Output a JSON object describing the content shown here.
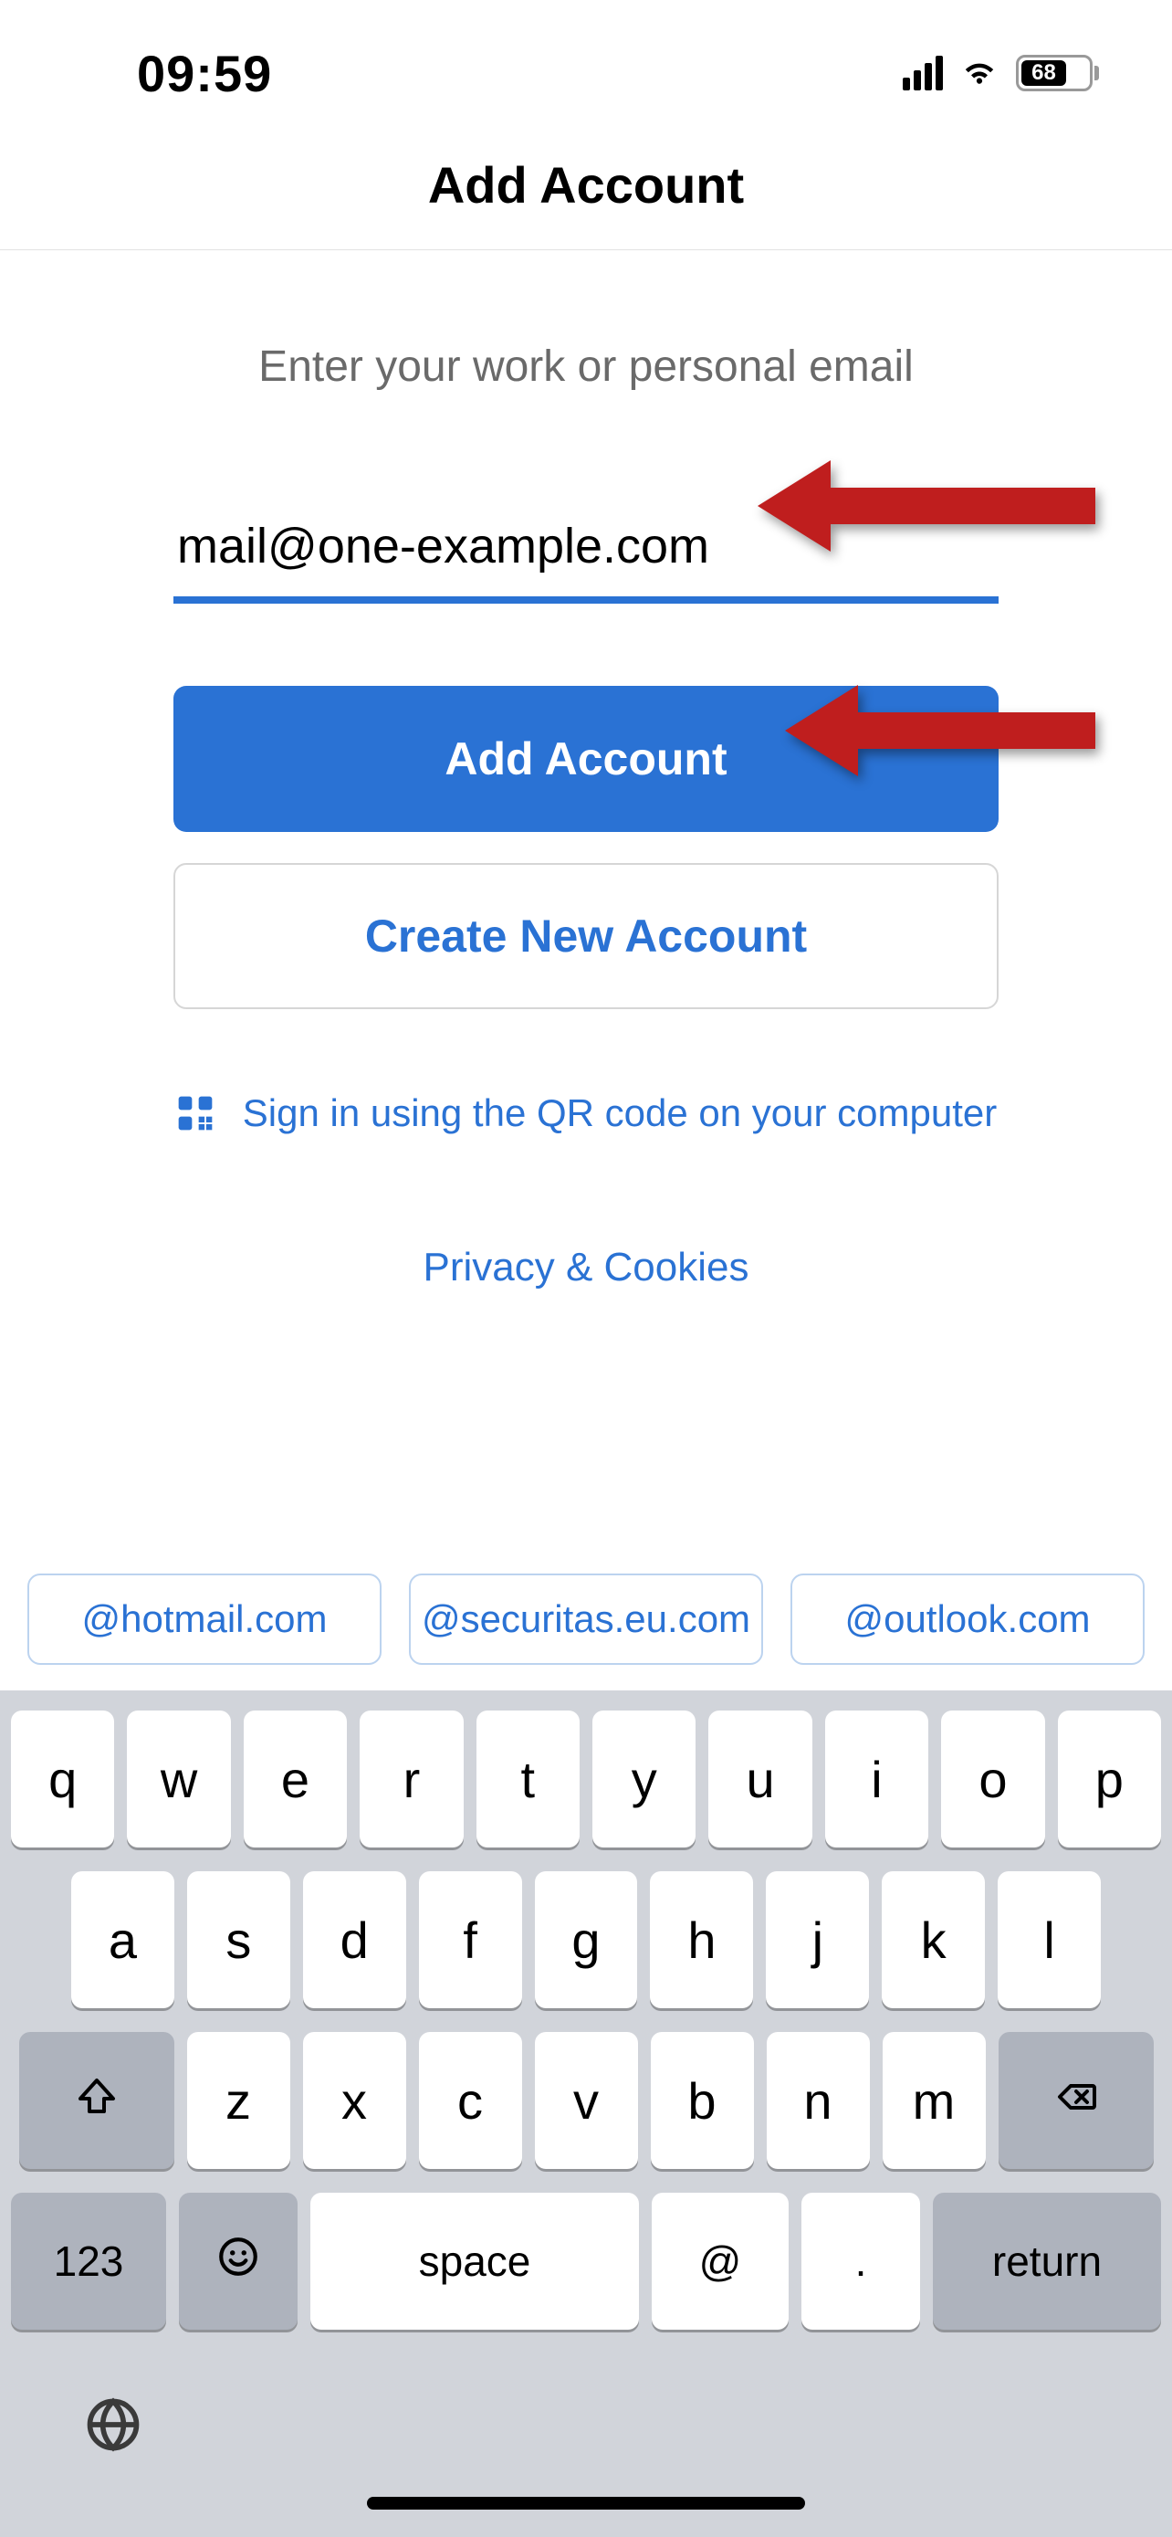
{
  "status": {
    "time": "09:59",
    "battery_pct": "68"
  },
  "header": {
    "title": "Add Account"
  },
  "form": {
    "prompt": "Enter your work or personal email",
    "email_value": "mail@one-example.com",
    "add_button": "Add Account",
    "create_button": "Create New Account",
    "qr_label": "Sign in using the QR code on your computer",
    "privacy": "Privacy & Cookies"
  },
  "suggestions": [
    "@hotmail.com",
    "@securitas.eu.com",
    "@outlook.com"
  ],
  "keyboard": {
    "row1": [
      "q",
      "w",
      "e",
      "r",
      "t",
      "y",
      "u",
      "i",
      "o",
      "p"
    ],
    "row2": [
      "a",
      "s",
      "d",
      "f",
      "g",
      "h",
      "j",
      "k",
      "l"
    ],
    "row3": [
      "z",
      "x",
      "c",
      "v",
      "b",
      "n",
      "m"
    ],
    "numeric": "123",
    "space": "space",
    "at": "@",
    "dot": ".",
    "return": "return"
  }
}
